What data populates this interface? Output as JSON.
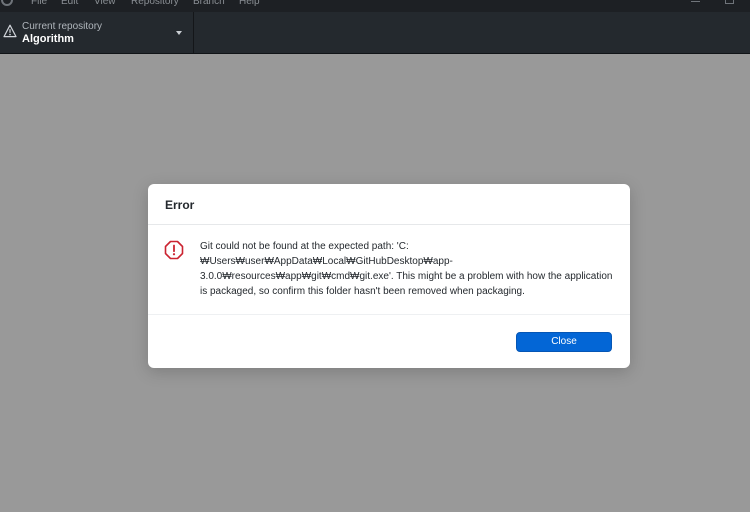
{
  "menu": {
    "items": [
      "File",
      "Edit",
      "View",
      "Repository",
      "Branch",
      "Help"
    ]
  },
  "toolbar": {
    "repository_caption": "Current repository",
    "repository_name": "Algorithm",
    "icons": [
      "warning-icon",
      "chevron-down-icon"
    ]
  },
  "dialog": {
    "title": "Error",
    "message": "Git could not be found at the expected path: 'C:₩Users₩user₩AppData₩Local₩GitHubDesktop₩app-3.0.0₩resources₩app₩git₩cmd₩git.exe'. This might be a problem with how the application is packaged, so confirm this folder hasn't been removed when packaging.",
    "close_label": "Close",
    "icon": "error-octagon-icon"
  },
  "colors": {
    "titlebar": "#1d2024",
    "toolbar": "#24292e",
    "overlay": "#999999",
    "button": "#0366d6",
    "error": "#cb2431"
  }
}
